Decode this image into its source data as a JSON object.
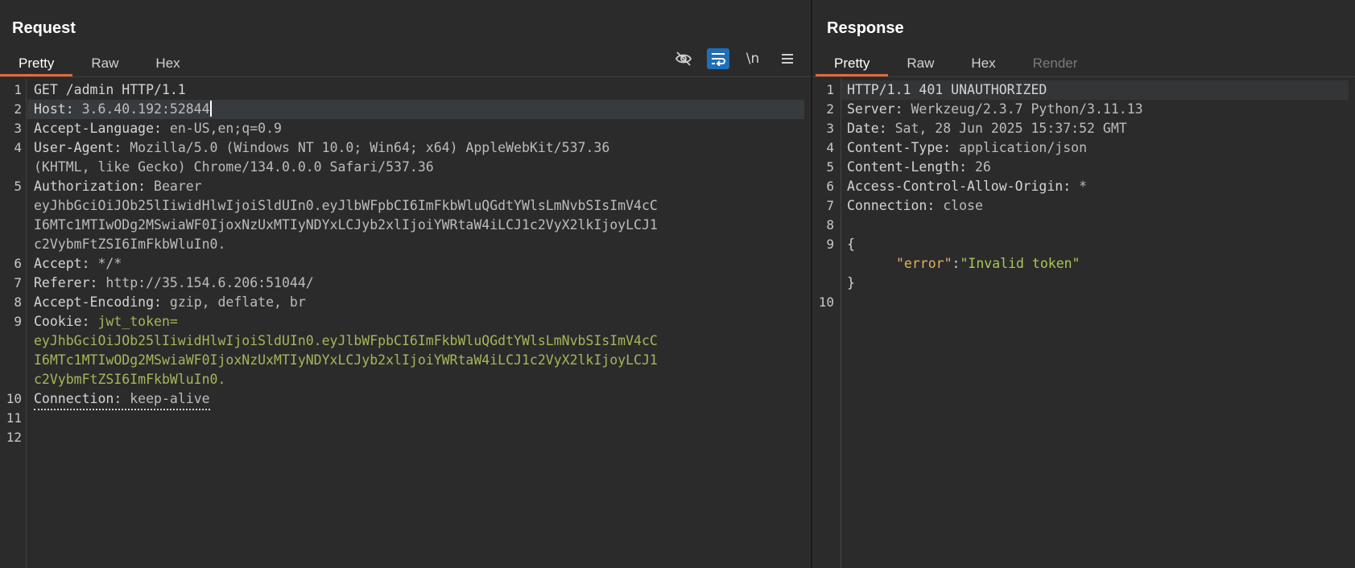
{
  "request": {
    "title": "Request",
    "tabs": [
      "Pretty",
      "Raw",
      "Hex"
    ],
    "active_tab": "Pretty",
    "tools": [
      "eye-slash-icon",
      "wrap-icon",
      "newline-icon",
      "menu-icon"
    ],
    "newline_label": "\\n",
    "lines": [
      {
        "n": "1",
        "text": "GET /admin HTTP/1.1"
      },
      {
        "n": "2",
        "key": "Host: ",
        "value": "3.6.40.192:52844"
      },
      {
        "n": "3",
        "key": "Accept-Language: ",
        "value": "en-US,en;q=0.9"
      },
      {
        "n": "4",
        "key": "User-Agent: ",
        "value": "Mozilla/5.0 (Windows NT 10.0; Win64; x64) AppleWebKit/537.36"
      },
      {
        "n": "",
        "value": "(KHTML, like Gecko) Chrome/134.0.0.0 Safari/537.36"
      },
      {
        "n": "5",
        "key": "Authorization: ",
        "value": "Bearer"
      },
      {
        "n": "",
        "value": "eyJhbGciOiJOb25lIiwidHlwIjoiSldUIn0.eyJlbWFpbCI6ImFkbWluQGdtYWlsLmNvbSIsImV4cC"
      },
      {
        "n": "",
        "value": "I6MTc1MTIwODg2MSwiaWF0IjoxNzUxMTIyNDYxLCJyb2xlIjoiYWRtaW4iLCJ1c2VyX2lkIjoyLCJ1"
      },
      {
        "n": "",
        "value": "c2VybmFtZSI6ImFkbWluIn0."
      },
      {
        "n": "6",
        "key": "Accept: ",
        "value": "*/*"
      },
      {
        "n": "7",
        "key": "Referer: ",
        "value": "http://35.154.6.206:51044/"
      },
      {
        "n": "8",
        "key": "Accept-Encoding: ",
        "value": "gzip, deflate, br"
      },
      {
        "n": "9",
        "key": "Cookie: ",
        "value": "jwt_token="
      },
      {
        "n": "",
        "value": "eyJhbGciOiJOb25lIiwidHlwIjoiSldUIn0.eyJlbWFpbCI6ImFkbWluQGdtYWlsLmNvbSIsImV4cC"
      },
      {
        "n": "",
        "value": "I6MTc1MTIwODg2MSwiaWF0IjoxNzUxMTIyNDYxLCJyb2xlIjoiYWRtaW4iLCJ1c2VyX2lkIjoyLCJ1"
      },
      {
        "n": "",
        "value": "c2VybmFtZSI6ImFkbWluIn0."
      },
      {
        "n": "10",
        "key": "Connection: ",
        "value": "keep-alive"
      },
      {
        "n": "11",
        "text": ""
      },
      {
        "n": "12",
        "text": ""
      }
    ]
  },
  "response": {
    "title": "Response",
    "tabs": [
      "Pretty",
      "Raw",
      "Hex",
      "Render"
    ],
    "active_tab": "Pretty",
    "disabled_tab": "Render",
    "lines": [
      {
        "n": "1",
        "text": "HTTP/1.1 401 UNAUTHORIZED"
      },
      {
        "n": "2",
        "key": "Server: ",
        "value": "Werkzeug/2.3.7 Python/3.11.13"
      },
      {
        "n": "3",
        "key": "Date: ",
        "value": "Sat, 28 Jun 2025 15:37:52 GMT"
      },
      {
        "n": "4",
        "key": "Content-Type: ",
        "value": "application/json"
      },
      {
        "n": "5",
        "key": "Content-Length: ",
        "value": "26"
      },
      {
        "n": "6",
        "key": "Access-Control-Allow-Origin: ",
        "value": "*"
      },
      {
        "n": "7",
        "key": "Connection: ",
        "value": "close"
      },
      {
        "n": "8",
        "text": ""
      },
      {
        "n": "9",
        "text": "{"
      },
      {
        "n": "",
        "json_key": "\"error\"",
        "json_sep": ":",
        "json_val": "\"Invalid token\""
      },
      {
        "n": "",
        "text": "}"
      },
      {
        "n": "10",
        "text": ""
      }
    ]
  }
}
